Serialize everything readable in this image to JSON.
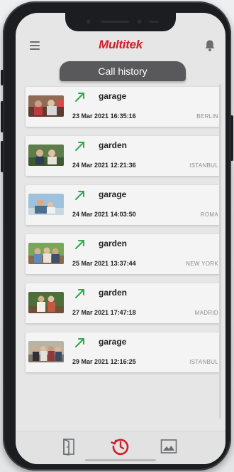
{
  "app": {
    "logo": "Multitek",
    "page_title": "Call history"
  },
  "icons": {
    "menu": "hamburger-menu-icon",
    "notifications": "bell-icon",
    "call_direction": "outgoing-arrow-icon",
    "nav_door": "door-icon",
    "nav_history": "history-icon",
    "nav_gallery": "gallery-icon"
  },
  "colors": {
    "brand": "#d01f2a",
    "arrow": "#2eaa4f",
    "pill": "#59595b",
    "history_active": "#d01f2a"
  },
  "calls": [
    {
      "location": "garage",
      "date": "23 Mar 2021",
      "time": "16:35:16",
      "city": "BERLIN"
    },
    {
      "location": "garden",
      "date": "24 Mar 2021",
      "time": "12:21:36",
      "city": "ISTANBUL"
    },
    {
      "location": "garage",
      "date": "24 Mar 2021",
      "time": "14:03:50",
      "city": "ROMA"
    },
    {
      "location": "garden",
      "date": "25 Mar 2021",
      "time": "13:37:44",
      "city": "NEW YORK"
    },
    {
      "location": "garden",
      "date": "27 Mar 2021",
      "time": "17:47:18",
      "city": "MADRID"
    },
    {
      "location": "garage",
      "date": "29 Mar 2021",
      "time": "12:16:25",
      "city": "ISTANBUL"
    }
  ]
}
